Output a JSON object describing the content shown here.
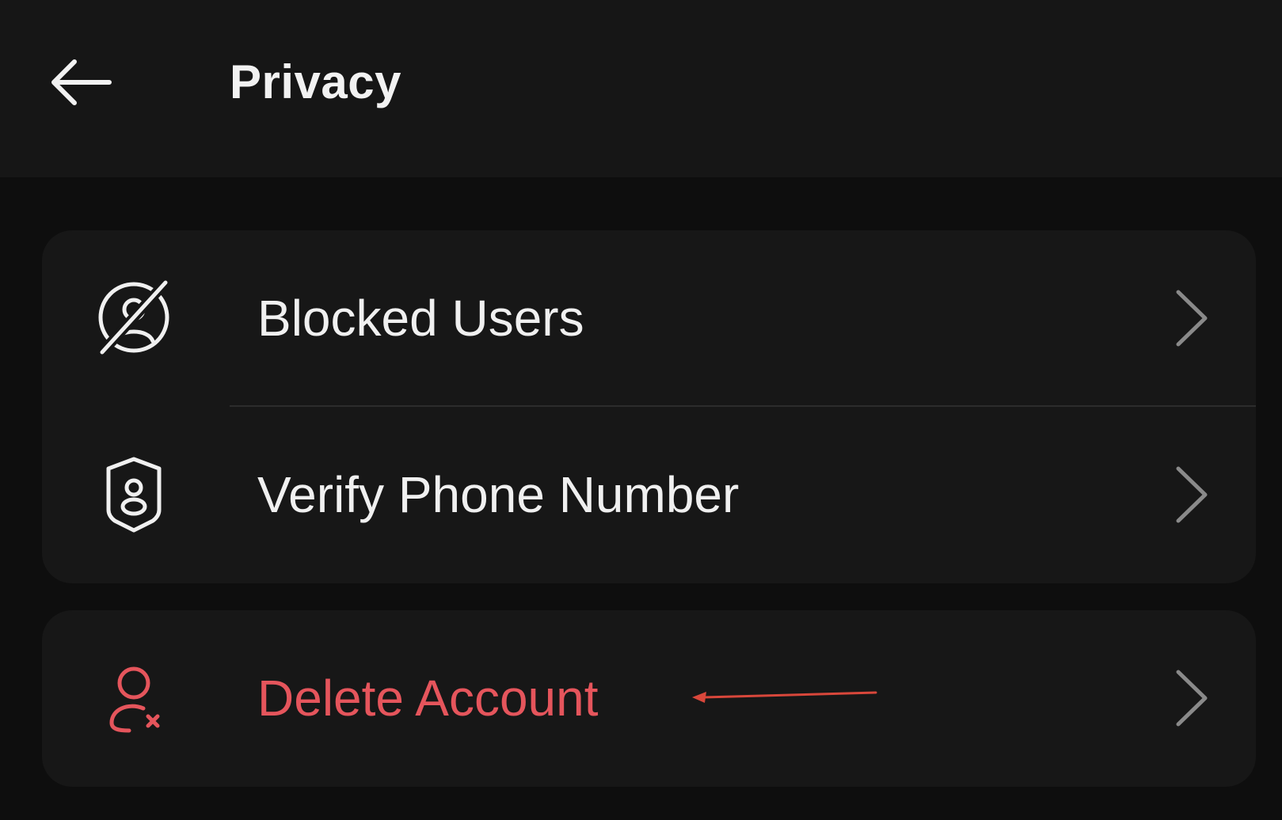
{
  "header": {
    "title": "Privacy",
    "back_icon": "arrow-left-icon"
  },
  "privacy_group": {
    "items": [
      {
        "label": "Blocked Users",
        "icon": "blocked-user-icon",
        "chevron": "chevron-right-icon"
      },
      {
        "label": "Verify Phone Number",
        "icon": "shield-user-icon",
        "chevron": "chevron-right-icon"
      }
    ]
  },
  "account_group": {
    "items": [
      {
        "label": "Delete Account",
        "icon": "delete-user-icon",
        "chevron": "chevron-right-icon"
      }
    ]
  },
  "colors": {
    "background": "#0e0e0e",
    "header_background": "#161616",
    "card_background": "#171717",
    "text_primary": "#f0f0f0",
    "danger": "#e5555c",
    "chevron": "#8a8a8a",
    "annotation_arrow": "#d9473b"
  }
}
